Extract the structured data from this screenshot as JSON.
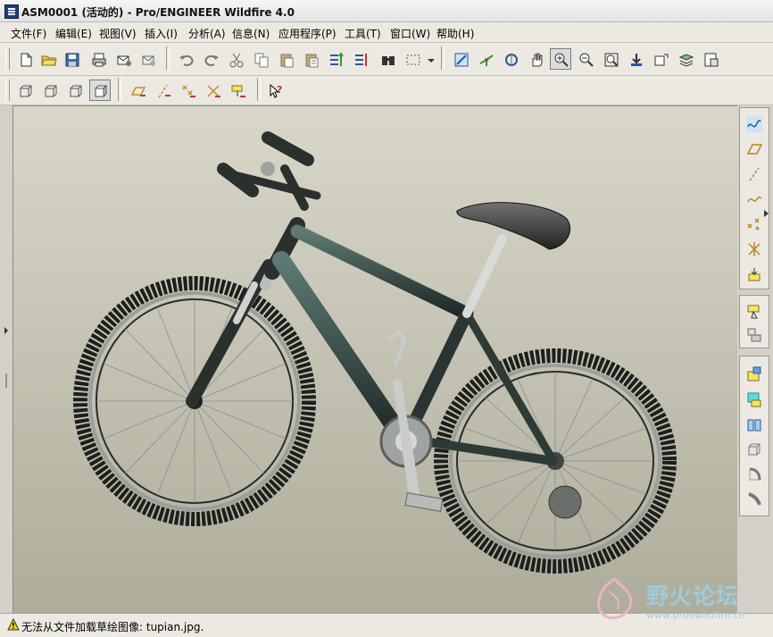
{
  "window": {
    "title": "ASM0001 (活动的) - Pro/ENGINEER Wildfire 4.0"
  },
  "menu": [
    {
      "label": "文件(F)"
    },
    {
      "label": "编辑(E)"
    },
    {
      "label": "视图(V)"
    },
    {
      "label": "插入(I)"
    },
    {
      "label": "分析(A)"
    },
    {
      "label": "信息(N)"
    },
    {
      "label": "应用程序(P)"
    },
    {
      "label": "工具(T)"
    },
    {
      "label": "窗口(W)"
    },
    {
      "label": "帮助(H)"
    }
  ],
  "toolbar_top": [
    {
      "icon": "new-file-icon"
    },
    {
      "icon": "open-folder-icon"
    },
    {
      "icon": "save-icon"
    },
    {
      "icon": "print-icon"
    },
    {
      "icon": "send-mail-icon"
    },
    {
      "icon": "mail-attach-icon"
    },
    {
      "icon": "undo-icon"
    },
    {
      "icon": "redo-icon"
    },
    {
      "icon": "cut-icon"
    },
    {
      "icon": "copy-icon"
    },
    {
      "icon": "paste-icon"
    },
    {
      "icon": "paste-special-icon"
    },
    {
      "icon": "regenerate-icon"
    },
    {
      "icon": "regen-manager-icon"
    },
    {
      "icon": "find-icon"
    },
    {
      "icon": "selection-box-icon"
    },
    {
      "icon": "sketch-view-icon"
    },
    {
      "icon": "spin-center-icon"
    },
    {
      "icon": "orient-mode-icon"
    },
    {
      "icon": "pan-hand-icon"
    },
    {
      "icon": "zoom-in-icon"
    },
    {
      "icon": "zoom-out-icon"
    },
    {
      "icon": "refit-icon"
    },
    {
      "icon": "reorient-icon"
    },
    {
      "icon": "saved-views-icon"
    },
    {
      "icon": "layers-icon"
    },
    {
      "icon": "view-manager-icon"
    }
  ],
  "toolbar_second": [
    {
      "icon": "wireframe-icon"
    },
    {
      "icon": "hidden-line-icon"
    },
    {
      "icon": "no-hidden-icon"
    },
    {
      "icon": "shading-icon"
    },
    {
      "icon": "datum-plane-display-icon"
    },
    {
      "icon": "datum-axis-display-icon"
    },
    {
      "icon": "datum-point-display-icon"
    },
    {
      "icon": "csys-display-icon"
    },
    {
      "icon": "annotation-display-icon"
    },
    {
      "icon": "context-help-icon"
    }
  ],
  "right_toolbar": [
    {
      "icon": "datum-curve-sketch-icon"
    },
    {
      "icon": "datum-plane-icon"
    },
    {
      "icon": "datum-axis-icon"
    },
    {
      "icon": "datum-curve-icon"
    },
    {
      "icon": "datum-point-icon"
    },
    {
      "icon": "datum-csys-icon"
    },
    {
      "icon": "analysis-feature-icon"
    },
    {
      "icon": "assemble-component-icon"
    },
    {
      "icon": "create-component-icon"
    },
    {
      "icon": "component-placement-icon"
    },
    {
      "icon": "component-create-icon"
    },
    {
      "icon": "mirror-icon"
    },
    {
      "icon": "extrude-icon"
    },
    {
      "icon": "revolve-icon"
    },
    {
      "icon": "sweep-icon"
    }
  ],
  "status": {
    "message": "无法从文件加载草绘图像: tupian.jpg."
  },
  "watermark": {
    "text": "野火论坛",
    "url": "www.proewildfire.cn"
  },
  "colors": {
    "viewport_top": "#d9d7c9",
    "viewport_bottom": "#aeac9b",
    "frame_color": "#2d3a36",
    "tire_color": "#1d1f1d"
  }
}
